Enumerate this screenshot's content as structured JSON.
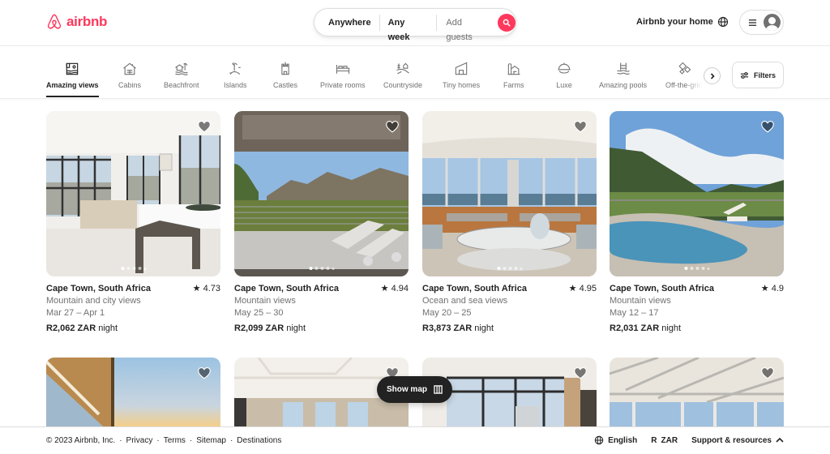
{
  "header": {
    "brand": "airbnb",
    "brand_color": "#ff385c",
    "search": {
      "location": "Anywhere",
      "dates": "Any week",
      "guests_placeholder": "Add guests",
      "search_icon": "search-icon"
    },
    "host_link": "Airbnb your home",
    "globe_icon": "globe-icon",
    "menu_icon": "hamburger-icon",
    "avatar_icon": "user-avatar-icon"
  },
  "categories": {
    "items": [
      {
        "label": "Amazing views",
        "icon": "amazing-views-icon",
        "active": true
      },
      {
        "label": "Cabins",
        "icon": "cabin-icon"
      },
      {
        "label": "Beachfront",
        "icon": "beachfront-icon"
      },
      {
        "label": "Islands",
        "icon": "island-icon"
      },
      {
        "label": "Castles",
        "icon": "castle-icon"
      },
      {
        "label": "Private rooms",
        "icon": "bed-icon"
      },
      {
        "label": "Countryside",
        "icon": "countryside-icon"
      },
      {
        "label": "Tiny homes",
        "icon": "tiny-home-icon"
      },
      {
        "label": "Farms",
        "icon": "farm-icon"
      },
      {
        "label": "Luxe",
        "icon": "luxe-icon"
      },
      {
        "label": "Amazing pools",
        "icon": "pool-icon"
      },
      {
        "label": "Off-the-grid",
        "icon": "off-grid-icon"
      }
    ],
    "next_icon": "chevron-right-icon",
    "filters_label": "Filters",
    "filters_icon": "sliders-icon"
  },
  "listings": [
    {
      "location": "Cape Town, South Africa",
      "rating": "4.73",
      "subtitle": "Mountain and city views",
      "dates": "Mar 27 – Apr 1",
      "price": "R2,062 ZAR",
      "price_unit": "night",
      "saved": false
    },
    {
      "location": "Cape Town, South Africa",
      "rating": "4.94",
      "subtitle": "Mountain views",
      "dates": "May 25 – 30",
      "price": "R2,099 ZAR",
      "price_unit": "night",
      "saved": false
    },
    {
      "location": "Cape Town, South Africa",
      "rating": "4.95",
      "subtitle": "Ocean and sea views",
      "dates": "May 20 – 25",
      "price": "R3,873 ZAR",
      "price_unit": "night",
      "saved": false
    },
    {
      "location": "Cape Town, South Africa",
      "rating": "4.9",
      "subtitle": "Mountain views",
      "dates": "May 12 – 17",
      "price": "R2,031 ZAR",
      "price_unit": "night",
      "saved": false
    }
  ],
  "show_map": {
    "label": "Show map",
    "icon": "map-icon"
  },
  "footer": {
    "copyright": "© 2023 Airbnb, Inc.",
    "separator": "·",
    "links": [
      "Privacy",
      "Terms",
      "Sitemap",
      "Destinations"
    ],
    "language": "English",
    "currency_symbol": "R",
    "currency": "ZAR",
    "support": "Support & resources"
  }
}
